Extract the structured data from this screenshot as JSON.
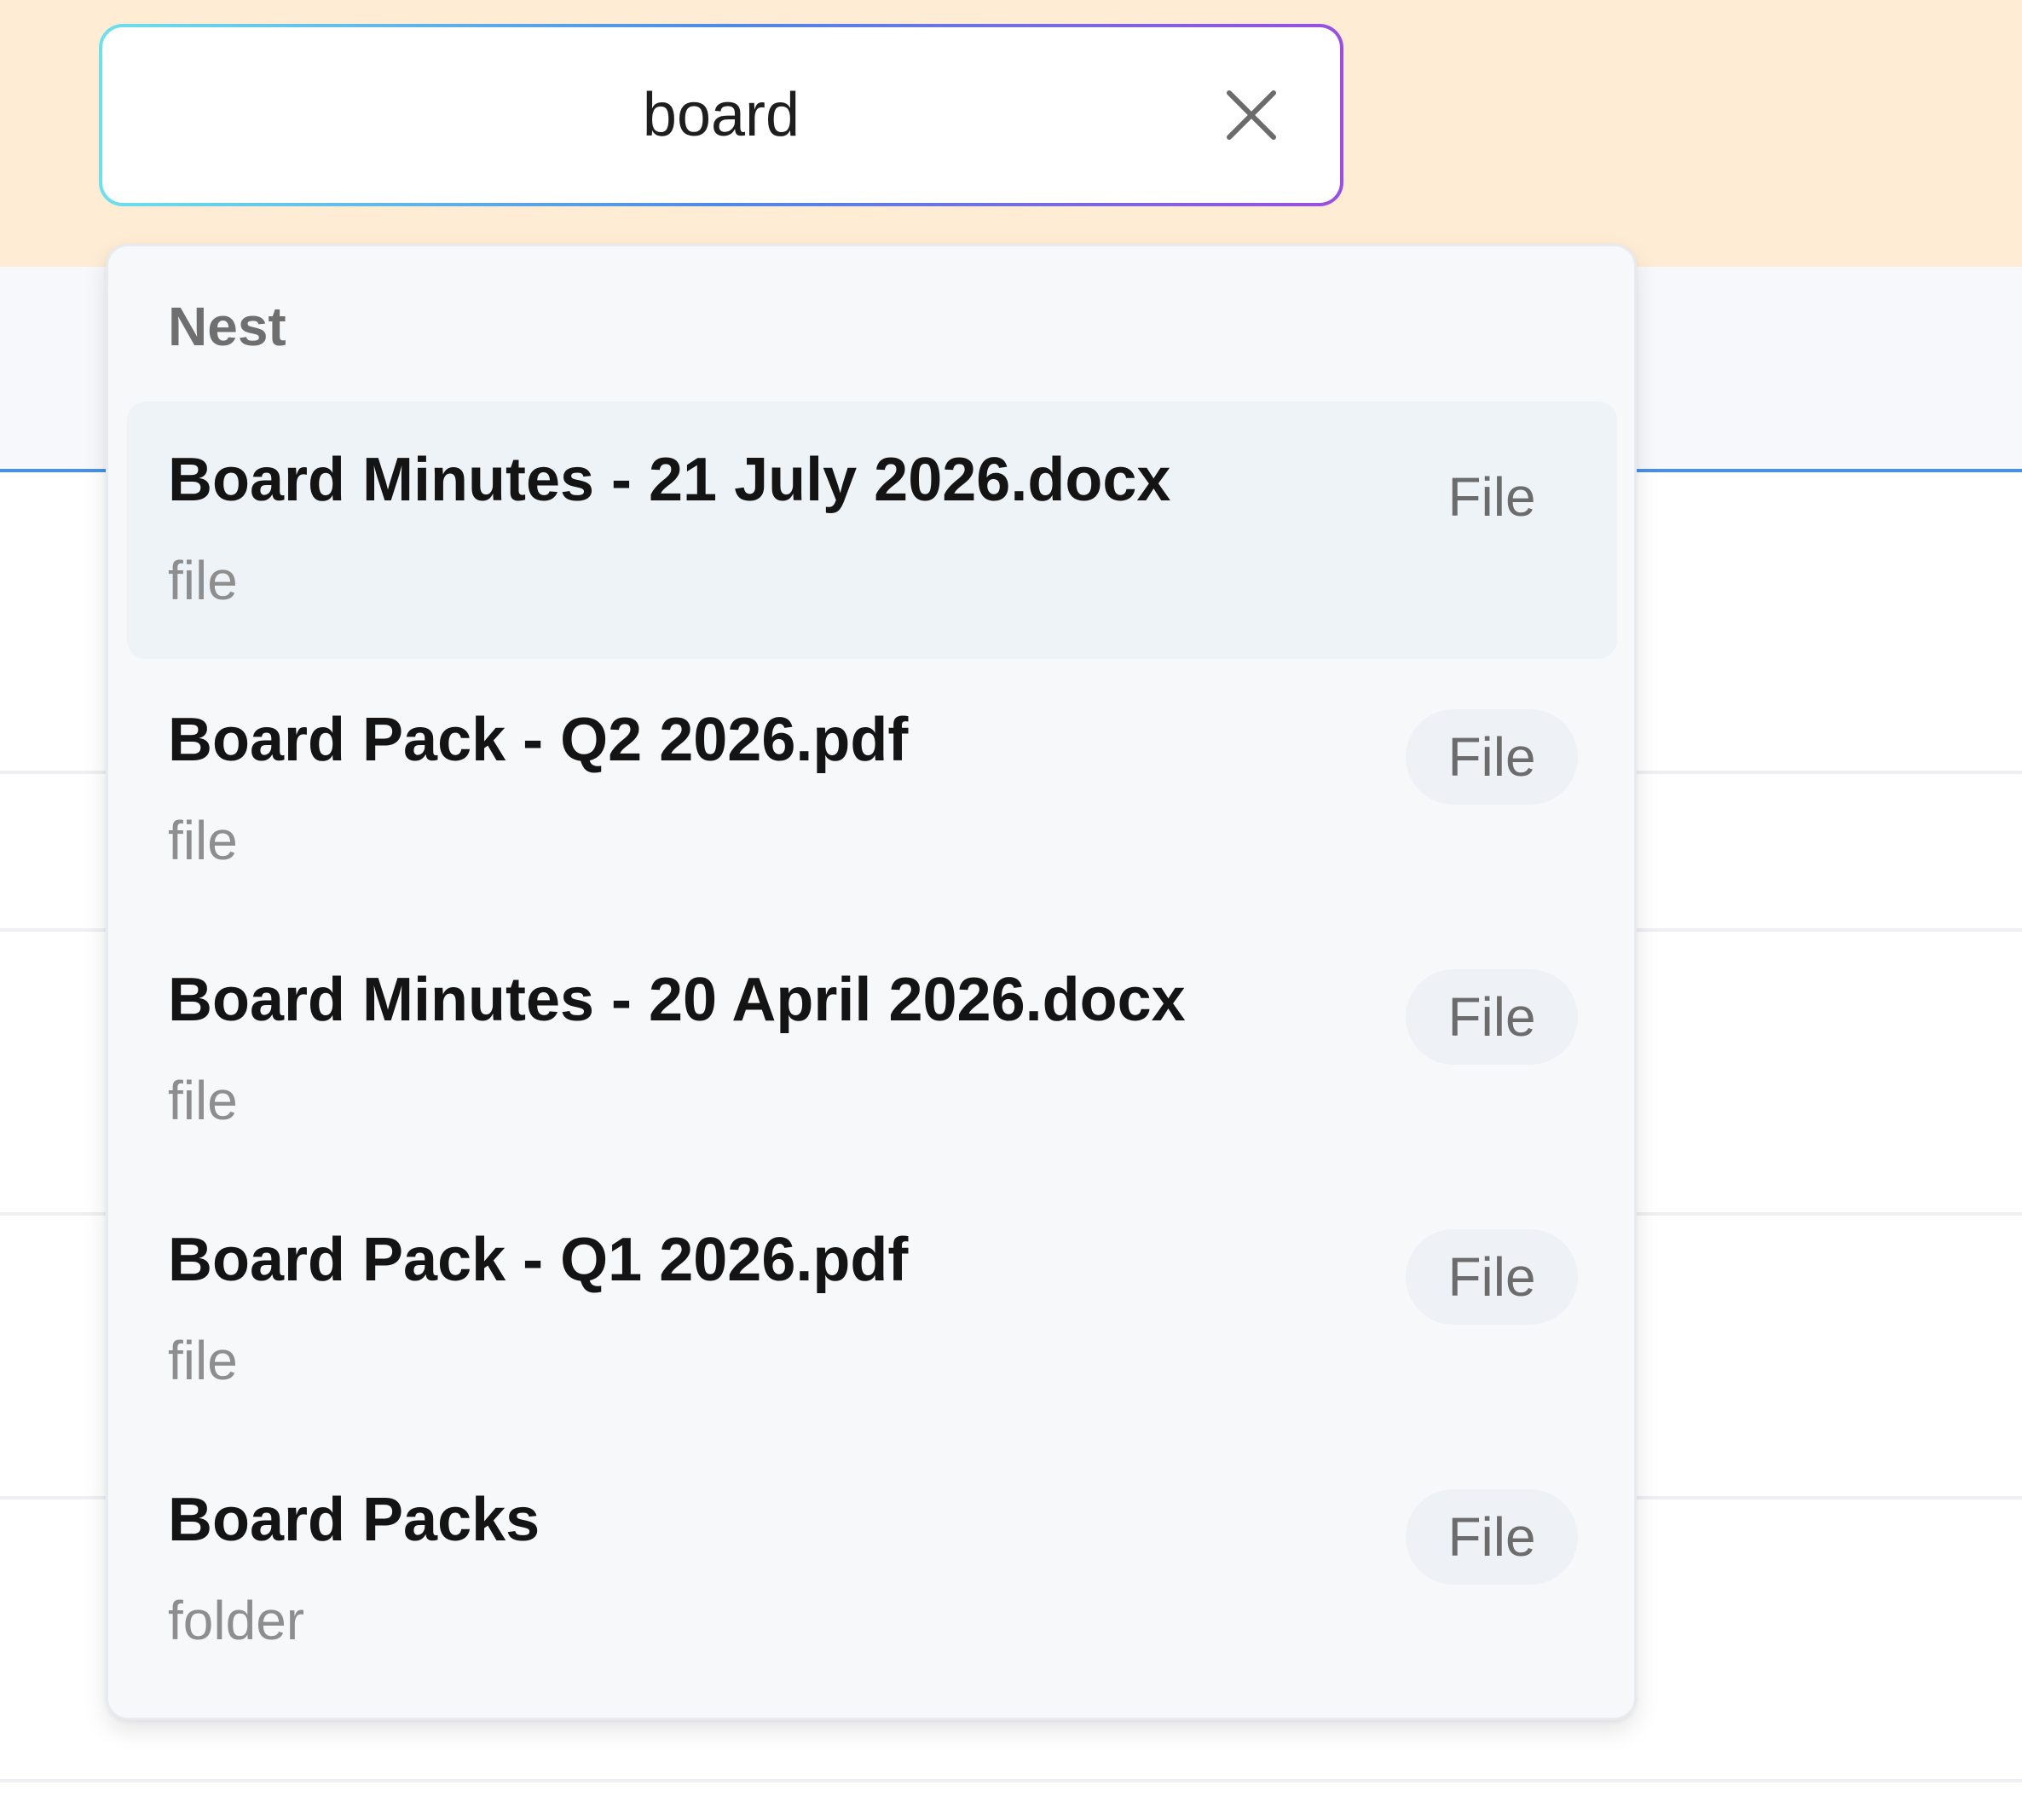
{
  "search": {
    "value": "board",
    "clear_icon": "close-icon"
  },
  "dropdown": {
    "group_label": "Nest",
    "results": [
      {
        "title": "Board Minutes - 21 July 2026.docx",
        "type": "file",
        "badge": "File"
      },
      {
        "title": "Board Pack - Q2 2026.pdf",
        "type": "file",
        "badge": "File"
      },
      {
        "title": "Board Minutes - 20 April 2026.docx",
        "type": "file",
        "badge": "File"
      },
      {
        "title": "Board Pack - Q1 2026.pdf",
        "type": "file",
        "badge": "File"
      },
      {
        "title": "Board Packs",
        "type": "folder",
        "badge": "File"
      }
    ]
  },
  "colors": {
    "header_bg": "#feecd5",
    "accent_line": "#4a90e2",
    "gradient_start": "#6ee0ec",
    "gradient_end": "#9a4fe0"
  }
}
